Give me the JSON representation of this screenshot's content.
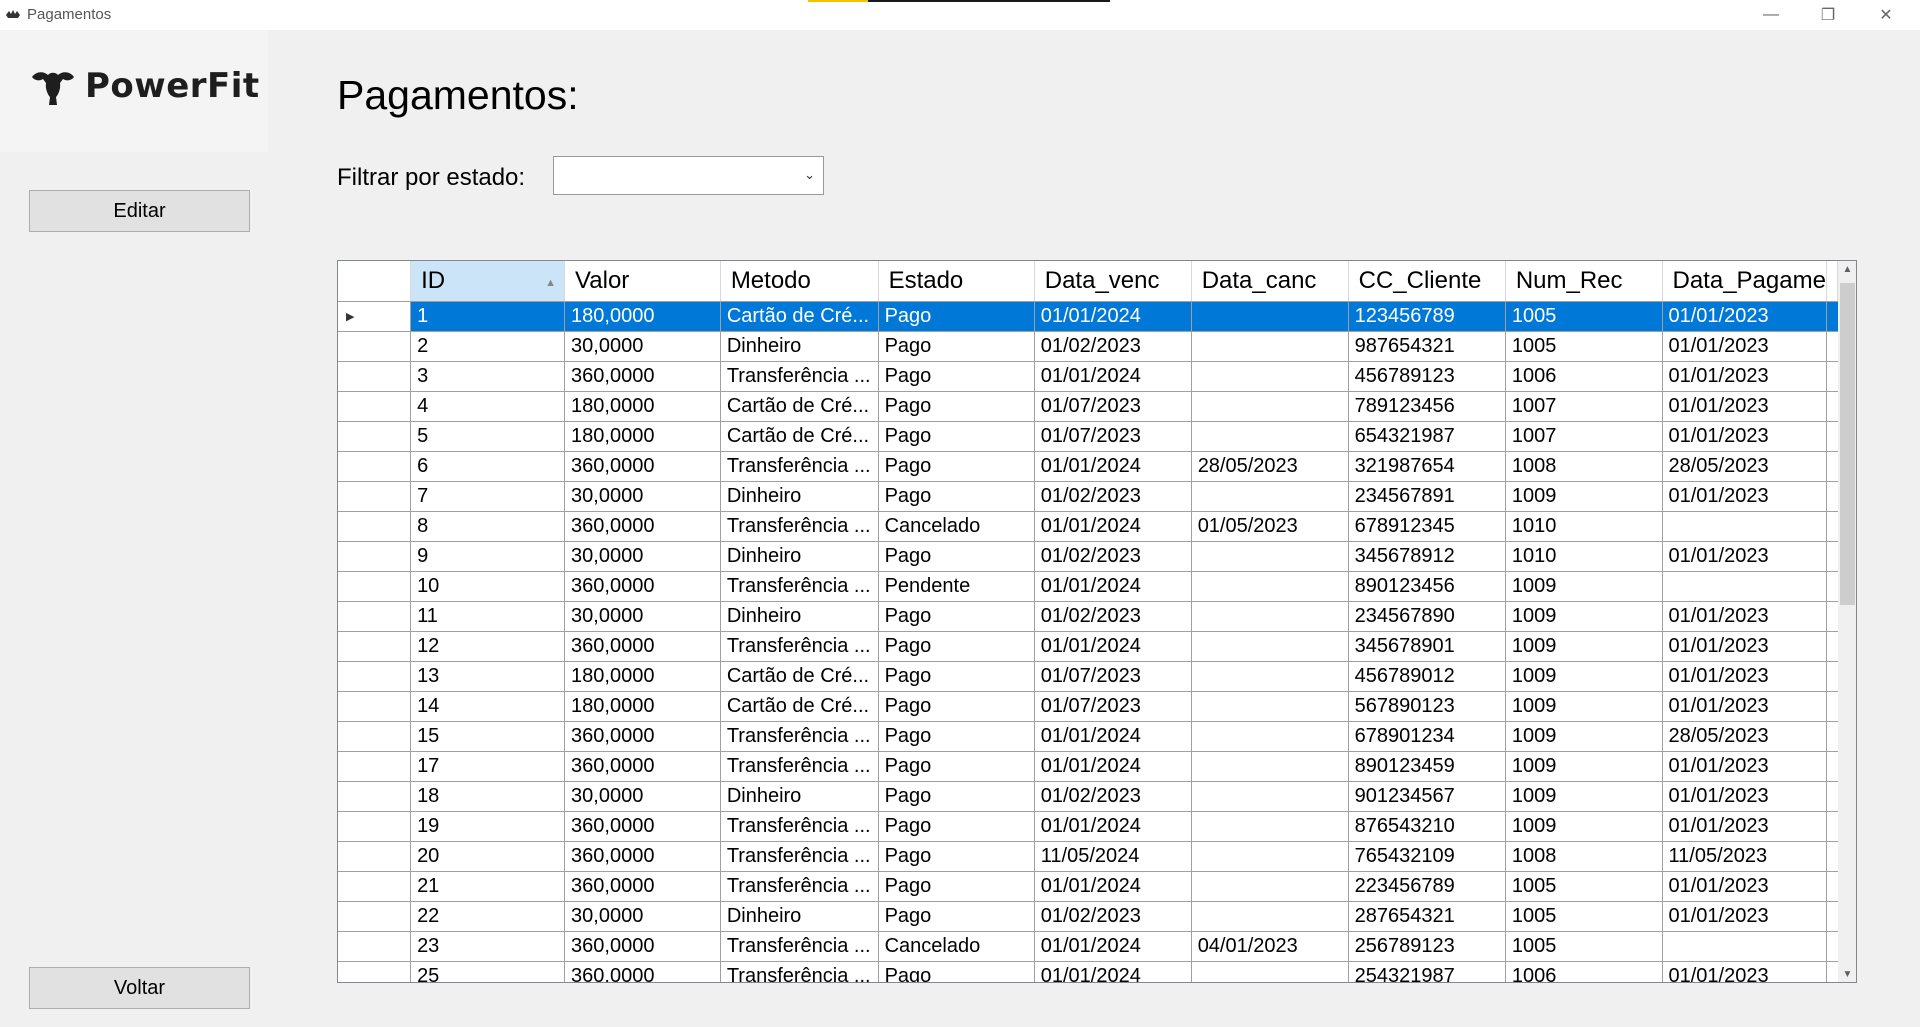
{
  "window": {
    "title": "Pagamentos",
    "controls": {
      "minimize": "—",
      "maximize": "❐",
      "close": "✕"
    }
  },
  "brand": {
    "name": "PowerFit",
    "icon": "muscle-arm-icon"
  },
  "sidebar": {
    "edit_label": "Editar",
    "back_label": "Voltar"
  },
  "main": {
    "title": "Pagamentos:",
    "filter_label": "Filtrar por estado:",
    "filter_value": ""
  },
  "colors": {
    "selection": "#0078d7",
    "sorted_header": "#cce4f7"
  },
  "grid": {
    "sort_column": "ID",
    "sort_direction": "ascending",
    "selected_row": 0,
    "columns": [
      "ID",
      "Valor",
      "Metodo",
      "Estado",
      "Data_venc",
      "Data_canc",
      "CC_Cliente",
      "Num_Rec",
      "Data_Pagame"
    ],
    "rows": [
      [
        "1",
        "180,0000",
        "Cartão de Cré...",
        "Pago",
        "01/01/2024",
        "",
        "123456789",
        "1005",
        "01/01/2023"
      ],
      [
        "2",
        "30,0000",
        "Dinheiro",
        "Pago",
        "01/02/2023",
        "",
        "987654321",
        "1005",
        "01/01/2023"
      ],
      [
        "3",
        "360,0000",
        "Transferência ...",
        "Pago",
        "01/01/2024",
        "",
        "456789123",
        "1006",
        "01/01/2023"
      ],
      [
        "4",
        "180,0000",
        "Cartão de Cré...",
        "Pago",
        "01/07/2023",
        "",
        "789123456",
        "1007",
        "01/01/2023"
      ],
      [
        "5",
        "180,0000",
        "Cartão de Cré...",
        "Pago",
        "01/07/2023",
        "",
        "654321987",
        "1007",
        "01/01/2023"
      ],
      [
        "6",
        "360,0000",
        "Transferência ...",
        "Pago",
        "01/01/2024",
        "28/05/2023",
        "321987654",
        "1008",
        "28/05/2023"
      ],
      [
        "7",
        "30,0000",
        "Dinheiro",
        "Pago",
        "01/02/2023",
        "",
        "234567891",
        "1009",
        "01/01/2023"
      ],
      [
        "8",
        "360,0000",
        "Transferência ...",
        "Cancelado",
        "01/01/2024",
        "01/05/2023",
        "678912345",
        "1010",
        ""
      ],
      [
        "9",
        "30,0000",
        "Dinheiro",
        "Pago",
        "01/02/2023",
        "",
        "345678912",
        "1010",
        "01/01/2023"
      ],
      [
        "10",
        "360,0000",
        "Transferência ...",
        "Pendente",
        "01/01/2024",
        "",
        "890123456",
        "1009",
        ""
      ],
      [
        "11",
        "30,0000",
        "Dinheiro",
        "Pago",
        "01/02/2023",
        "",
        "234567890",
        "1009",
        "01/01/2023"
      ],
      [
        "12",
        "360,0000",
        "Transferência ...",
        "Pago",
        "01/01/2024",
        "",
        "345678901",
        "1009",
        "01/01/2023"
      ],
      [
        "13",
        "180,0000",
        "Cartão de Cré...",
        "Pago",
        "01/07/2023",
        "",
        "456789012",
        "1009",
        "01/01/2023"
      ],
      [
        "14",
        "180,0000",
        "Cartão de Cré...",
        "Pago",
        "01/07/2023",
        "",
        "567890123",
        "1009",
        "01/01/2023"
      ],
      [
        "15",
        "360,0000",
        "Transferência ...",
        "Pago",
        "01/01/2024",
        "",
        "678901234",
        "1009",
        "28/05/2023"
      ],
      [
        "17",
        "360,0000",
        "Transferência ...",
        "Pago",
        "01/01/2024",
        "",
        "890123459",
        "1009",
        "01/01/2023"
      ],
      [
        "18",
        "30,0000",
        "Dinheiro",
        "Pago",
        "01/02/2023",
        "",
        "901234567",
        "1009",
        "01/01/2023"
      ],
      [
        "19",
        "360,0000",
        "Transferência ...",
        "Pago",
        "01/01/2024",
        "",
        "876543210",
        "1009",
        "01/01/2023"
      ],
      [
        "20",
        "360,0000",
        "Transferência ...",
        "Pago",
        "11/05/2024",
        "",
        "765432109",
        "1008",
        "11/05/2023"
      ],
      [
        "21",
        "360,0000",
        "Transferência ...",
        "Pago",
        "01/01/2024",
        "",
        "223456789",
        "1005",
        "01/01/2023"
      ],
      [
        "22",
        "30,0000",
        "Dinheiro",
        "Pago",
        "01/02/2023",
        "",
        "287654321",
        "1005",
        "01/01/2023"
      ],
      [
        "23",
        "360,0000",
        "Transferência ...",
        "Cancelado",
        "01/01/2024",
        "04/01/2023",
        "256789123",
        "1005",
        ""
      ],
      [
        "25",
        "360,0000",
        "Transferência ...",
        "Pago",
        "01/01/2024",
        "",
        "254321987",
        "1006",
        "01/01/2023"
      ]
    ]
  }
}
